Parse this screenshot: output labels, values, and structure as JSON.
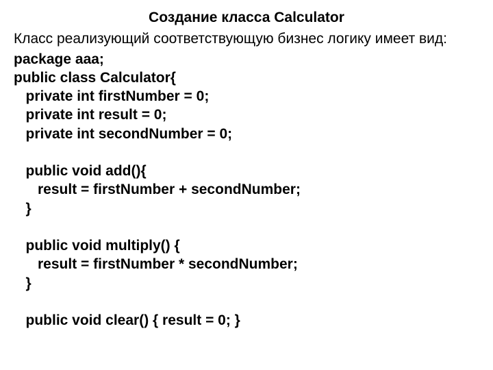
{
  "title": "Создание класса Calculator",
  "description": "Класс реализующий соответствующую бизнес логику имеет вид:",
  "code": {
    "l01": "package aaa;",
    "l02": "public class Calculator{",
    "l03": "   private int firstNumber = 0;",
    "l04": "   private int result = 0;",
    "l05": "   private int secondNumber = 0;",
    "l06": "   public void add(){",
    "l07": "      result = firstNumber + secondNumber;",
    "l08": "   }",
    "l09": "   public void multiply() {",
    "l10": "      result = firstNumber * secondNumber;",
    "l11": "   }",
    "l12": "   public void clear() { result = 0; }"
  }
}
